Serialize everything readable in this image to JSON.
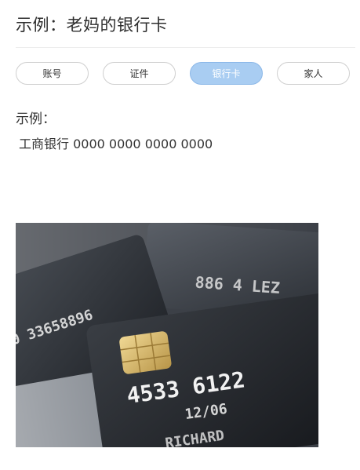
{
  "page": {
    "title": "示例：老妈的银行卡"
  },
  "tabs": [
    {
      "label": "账号",
      "active": false
    },
    {
      "label": "证件",
      "active": false
    },
    {
      "label": "银行卡",
      "active": true
    },
    {
      "label": "家人",
      "active": false
    }
  ],
  "example": {
    "label": "示例：",
    "value": "工商银行 0000 0000 0000 0000"
  },
  "photo": {
    "subject": "bank-cards-photo",
    "card_number_fragment": "4533 6122",
    "card_number_fragment_2": "0 33658896",
    "expiry": "12/06",
    "holder_fragment": "RICHARD"
  },
  "colors": {
    "active_tab_bg": "#a9cdf2",
    "tab_border": "#cfcfcf",
    "chip_gold": "#d8b96a"
  }
}
